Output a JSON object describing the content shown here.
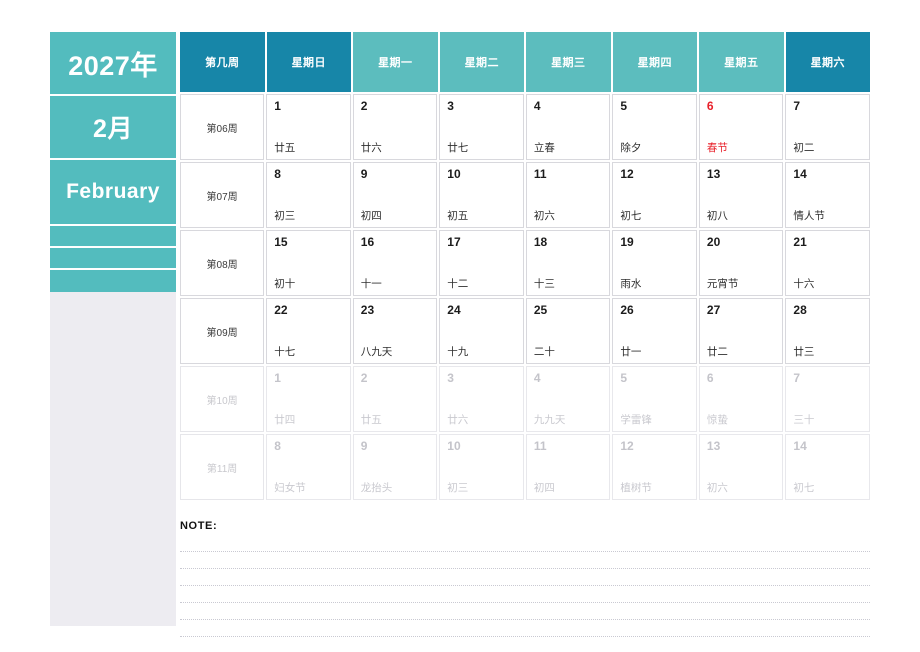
{
  "sidebar": {
    "year_label": "2027年",
    "month_label": "2月",
    "english_month": "February",
    "blank_bands": 3,
    "band_color": "#53bcbe",
    "panel_color": "#edecf1"
  },
  "header": {
    "accent_dark": "#1786a8",
    "accent_light": "#5cbdbe",
    "columns": [
      {
        "label": "第几周",
        "dark": true
      },
      {
        "label": "星期日",
        "dark": true
      },
      {
        "label": "星期一",
        "dark": false
      },
      {
        "label": "星期二",
        "dark": false
      },
      {
        "label": "星期三",
        "dark": false
      },
      {
        "label": "星期四",
        "dark": false
      },
      {
        "label": "星期五",
        "dark": false
      },
      {
        "label": "星期六",
        "dark": true
      }
    ]
  },
  "holiday_color": "#e8202a",
  "weeks": [
    {
      "week_label": "第06周",
      "out_of_month": false,
      "days": [
        {
          "num": "1",
          "lunar": "廿五",
          "holiday": false
        },
        {
          "num": "2",
          "lunar": "廿六",
          "holiday": false
        },
        {
          "num": "3",
          "lunar": "廿七",
          "holiday": false
        },
        {
          "num": "4",
          "lunar": "立春",
          "holiday": false
        },
        {
          "num": "5",
          "lunar": "除夕",
          "holiday": false
        },
        {
          "num": "6",
          "lunar": "春节",
          "holiday": true
        },
        {
          "num": "7",
          "lunar": "初二",
          "holiday": false
        }
      ]
    },
    {
      "week_label": "第07周",
      "out_of_month": false,
      "days": [
        {
          "num": "8",
          "lunar": "初三",
          "holiday": false
        },
        {
          "num": "9",
          "lunar": "初四",
          "holiday": false
        },
        {
          "num": "10",
          "lunar": "初五",
          "holiday": false
        },
        {
          "num": "11",
          "lunar": "初六",
          "holiday": false
        },
        {
          "num": "12",
          "lunar": "初七",
          "holiday": false
        },
        {
          "num": "13",
          "lunar": "初八",
          "holiday": false
        },
        {
          "num": "14",
          "lunar": "情人节",
          "holiday": false
        }
      ]
    },
    {
      "week_label": "第08周",
      "out_of_month": false,
      "days": [
        {
          "num": "15",
          "lunar": "初十",
          "holiday": false
        },
        {
          "num": "16",
          "lunar": "十一",
          "holiday": false
        },
        {
          "num": "17",
          "lunar": "十二",
          "holiday": false
        },
        {
          "num": "18",
          "lunar": "十三",
          "holiday": false
        },
        {
          "num": "19",
          "lunar": "雨水",
          "holiday": false
        },
        {
          "num": "20",
          "lunar": "元宵节",
          "holiday": false
        },
        {
          "num": "21",
          "lunar": "十六",
          "holiday": false
        }
      ]
    },
    {
      "week_label": "第09周",
      "out_of_month": false,
      "days": [
        {
          "num": "22",
          "lunar": "十七",
          "holiday": false
        },
        {
          "num": "23",
          "lunar": "八九天",
          "holiday": false
        },
        {
          "num": "24",
          "lunar": "十九",
          "holiday": false
        },
        {
          "num": "25",
          "lunar": "二十",
          "holiday": false
        },
        {
          "num": "26",
          "lunar": "廿一",
          "holiday": false
        },
        {
          "num": "27",
          "lunar": "廿二",
          "holiday": false
        },
        {
          "num": "28",
          "lunar": "廿三",
          "holiday": false
        }
      ]
    },
    {
      "week_label": "第10周",
      "out_of_month": true,
      "days": [
        {
          "num": "1",
          "lunar": "廿四",
          "holiday": false
        },
        {
          "num": "2",
          "lunar": "廿五",
          "holiday": false
        },
        {
          "num": "3",
          "lunar": "廿六",
          "holiday": false
        },
        {
          "num": "4",
          "lunar": "九九天",
          "holiday": false
        },
        {
          "num": "5",
          "lunar": "学雷锋",
          "holiday": false
        },
        {
          "num": "6",
          "lunar": "惊蛰",
          "holiday": false
        },
        {
          "num": "7",
          "lunar": "三十",
          "holiday": false
        }
      ]
    },
    {
      "week_label": "第11周",
      "out_of_month": true,
      "days": [
        {
          "num": "8",
          "lunar": "妇女节",
          "holiday": false
        },
        {
          "num": "9",
          "lunar": "龙抬头",
          "holiday": false
        },
        {
          "num": "10",
          "lunar": "初三",
          "holiday": false
        },
        {
          "num": "11",
          "lunar": "初四",
          "holiday": false
        },
        {
          "num": "12",
          "lunar": "植树节",
          "holiday": false
        },
        {
          "num": "13",
          "lunar": "初六",
          "holiday": false
        },
        {
          "num": "14",
          "lunar": "初七",
          "holiday": false
        }
      ]
    }
  ],
  "note": {
    "label": "NOTE:",
    "line_count": 6
  }
}
